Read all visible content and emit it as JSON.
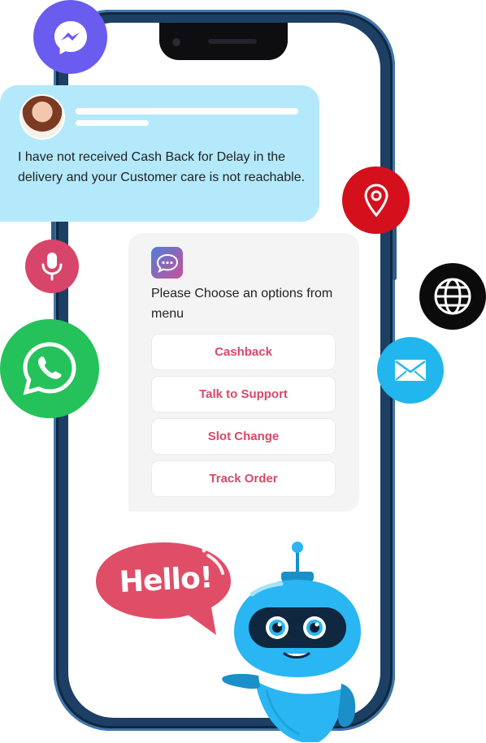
{
  "user_message": {
    "text": "I have not received Cash Back for Delay in the delivery and your Customer care is not reachable."
  },
  "bot_message": {
    "prompt": "Please Choose an options from menu",
    "options": [
      "Cashback",
      "Talk to Support",
      "Slot Change",
      "Track Order"
    ]
  },
  "hello_bubble": {
    "text": "Hello!"
  },
  "channel_icons": [
    {
      "name": "messenger-icon",
      "color": "#6b5cf0"
    },
    {
      "name": "location-pin-icon",
      "color": "#d4101d"
    },
    {
      "name": "microphone-icon",
      "color": "#d8456a"
    },
    {
      "name": "globe-icon",
      "color": "#0b0b0b"
    },
    {
      "name": "whatsapp-icon",
      "color": "#25c15a"
    },
    {
      "name": "email-icon",
      "color": "#22b6ef"
    }
  ],
  "colors": {
    "accent": "#d6496a",
    "user_bubble": "#b4e8fb",
    "bot_card": "#f4f4f4",
    "robot": "#29b6f2"
  }
}
